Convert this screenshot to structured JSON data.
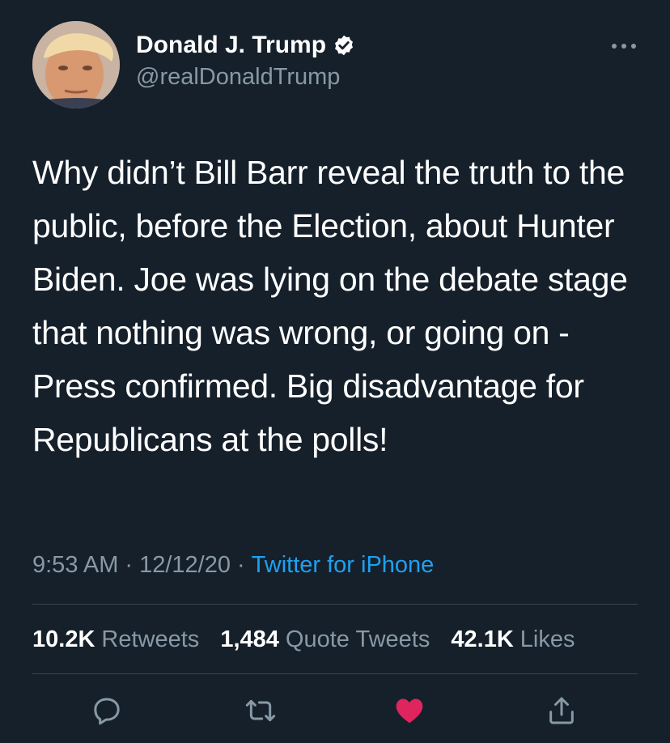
{
  "author": {
    "display_name": "Donald J. Trump",
    "handle": "@realDonaldTrump",
    "verified": true,
    "avatar_icon": "profile-photo"
  },
  "tweet": {
    "text": "Why didn’t Bill Barr reveal the truth to the public, before the Election, about Hunter Biden. Joe was lying on the debate stage that nothing was wrong, or going on - Press confirmed. Big disadvantage for Republicans at the polls!",
    "time": "9:53 AM",
    "date": "12/12/20",
    "separator": "·",
    "source": "Twitter for iPhone"
  },
  "stats": {
    "retweets_count": "10.2K",
    "retweets_label": "Retweets",
    "quotes_count": "1,484",
    "quotes_label": "Quote Tweets",
    "likes_count": "42.1K",
    "likes_label": "Likes"
  },
  "actions": {
    "reply_icon": "reply-icon",
    "retweet_icon": "retweet-icon",
    "like_icon": "heart-icon",
    "share_icon": "share-icon"
  },
  "colors": {
    "background": "#15202b",
    "text": "#ffffff",
    "secondary": "#8899a6",
    "accent": "#1da1f2",
    "like": "#e0245e",
    "divider": "#38444d"
  }
}
